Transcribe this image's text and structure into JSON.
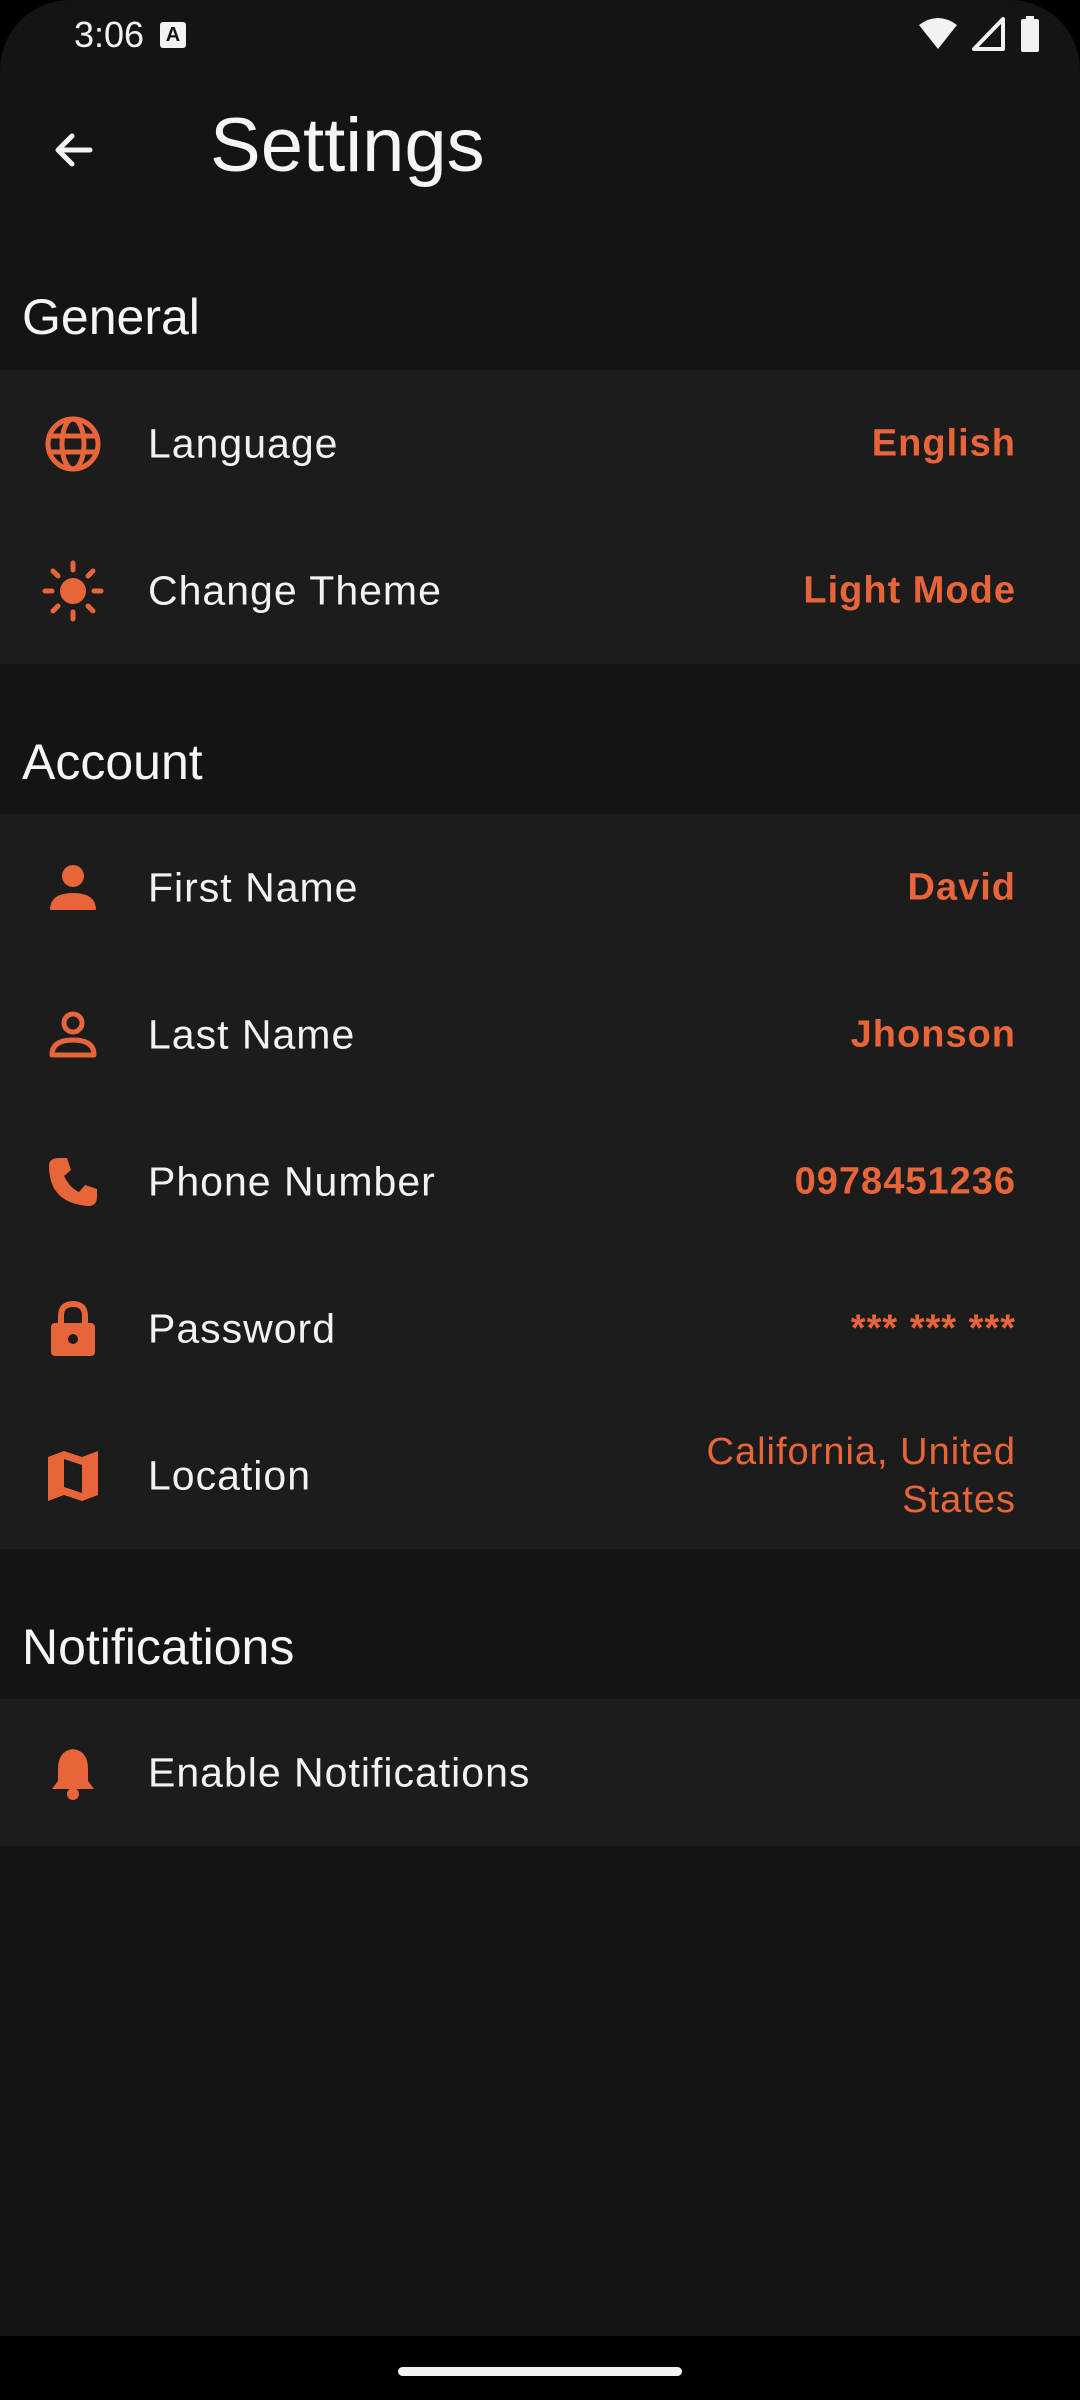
{
  "status_bar": {
    "time": "3:06",
    "notification_letter": "A"
  },
  "app_bar": {
    "title": "Settings"
  },
  "colors": {
    "accent": "#e8653a",
    "background": "#141414",
    "card": "#1c1c1c"
  },
  "general": {
    "header": "General",
    "items": [
      {
        "icon": "globe-icon",
        "label": "Language",
        "value": "English"
      },
      {
        "icon": "sun-icon",
        "label": "Change Theme",
        "value": "Light Mode"
      }
    ]
  },
  "account": {
    "header": "Account",
    "items": [
      {
        "icon": "person-icon",
        "label": "First Name",
        "value": "David"
      },
      {
        "icon": "person-outline-icon",
        "label": "Last Name",
        "value": "Jhonson"
      },
      {
        "icon": "phone-icon",
        "label": "Phone Number",
        "value": "0978451236"
      },
      {
        "icon": "lock-icon",
        "label": "Password",
        "value": "*** *** ***"
      },
      {
        "icon": "map-icon",
        "label": "Location",
        "value": "California, United States"
      }
    ]
  },
  "notifications": {
    "header": "Notifications",
    "items": [
      {
        "icon": "bell-icon",
        "label": "Enable Notifications"
      }
    ]
  }
}
